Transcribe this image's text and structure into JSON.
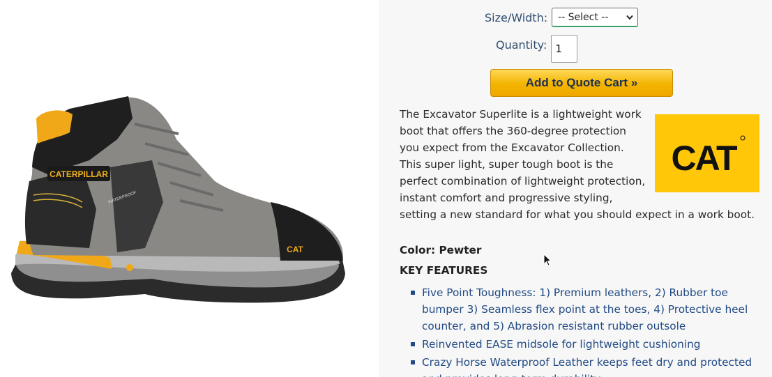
{
  "product": {
    "image_alt": "Caterpillar Excavator Superlite work boot in pewter",
    "boot_brand_text": "CATERPILLAR",
    "boot_badge_text": "CAT",
    "boot_tag_text": "WATERPROOF"
  },
  "form": {
    "size_label": "Size/Width:",
    "size_selected": "-- Select --",
    "quantity_label": "Quantity:",
    "quantity_value": "1",
    "add_button_label": "Add to Quote Cart »"
  },
  "description": {
    "text": "The Excavator Superlite is a lightweight work boot that offers the 360-degree protection you expect from the Excavator Collection. This super light, super tough boot is the perfect combination of lightweight protection, instant comfort and progressive styling, setting a new standard for what you should expect in a work boot.",
    "logo_text": "CAT"
  },
  "details": {
    "color_line": "Color: Pewter",
    "features_heading": "KEY FEATURES",
    "features": [
      "Five Point Toughness: 1) Premium leathers, 2) Rubber toe bumper 3) Seamless flex point at the toes, 4) Protective heel counter, and 5) Abrasion resistant rubber outsole",
      "Reinvented EASE midsole for lightweight cushioning",
      "Crazy Horse Waterproof Leather keeps feet dry and protected and provides long-term durability"
    ]
  },
  "colors": {
    "button_yellow": "#f4b400",
    "cat_yellow": "#ffc708",
    "link_blue": "#214a84",
    "label_blue": "#2f4d6f",
    "panel_grey": "#f7f7f7",
    "select_focus_green": "#3aa06a"
  },
  "icons": {
    "cursor": "arrow-cursor-icon",
    "dropdown": "chevron-down-icon",
    "logo": "cat-logo-icon"
  }
}
